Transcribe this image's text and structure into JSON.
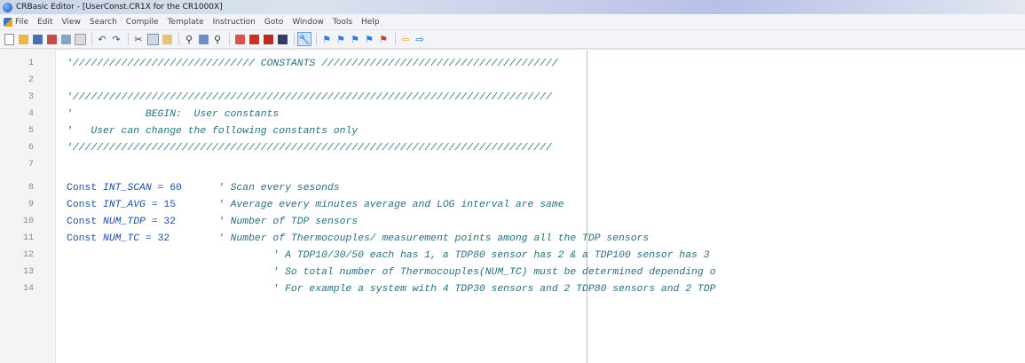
{
  "window": {
    "title": "CRBasic Editor - [UserConst.CR1X for the CR1000X]"
  },
  "menu": {
    "items": [
      "File",
      "Edit",
      "View",
      "Search",
      "Compile",
      "Template",
      "Instruction",
      "Goto",
      "Window",
      "Tools",
      "Help"
    ]
  },
  "toolbar": {
    "icons": [
      "new-file-icon",
      "open-file-icon",
      "save-icon",
      "save-all-icon",
      "print-icon",
      "print-preview-icon",
      "undo-icon",
      "redo-icon",
      "cut-icon",
      "copy-icon",
      "paste-icon",
      "find-icon",
      "replace-icon",
      "find-next-icon",
      "compile-icon",
      "compile-save-icon",
      "send-icon",
      "block-icon",
      "wrench-icon",
      "bookmark-toggle-icon",
      "bookmark-next-icon",
      "bookmark-prev-icon",
      "bookmark-clear-icon",
      "bookmark-list-icon",
      "back-arrow-icon",
      "forward-arrow-icon"
    ]
  },
  "editor": {
    "lines": [
      {
        "num": "1",
        "text": "'////////////////////////////// CONSTANTS ///////////////////////////////////////"
      },
      {
        "num": "2",
        "text": ""
      },
      {
        "num": "3",
        "text": "'///////////////////////////////////////////////////////////////////////////////"
      },
      {
        "num": "4",
        "text": "'            BEGIN:  User constants"
      },
      {
        "num": "5",
        "text": "'   User can change the following constants only"
      },
      {
        "num": "6",
        "text": "'///////////////////////////////////////////////////////////////////////////////"
      },
      {
        "num": "7",
        "text": ""
      },
      {
        "num": "8",
        "kw": "Const ",
        "var": "INT_SCAN",
        "op": " = 60",
        "cmt": "      ' Scan every sesonds"
      },
      {
        "num": "9",
        "kw": "Const ",
        "var": "INT_AVG",
        "op": " = 15",
        "cmt": "       ' Average every minutes average and LOG interval are same"
      },
      {
        "num": "10",
        "kw": "Const ",
        "var": "NUM_TDP",
        "op": " = 32",
        "cmt": "       ' Number of TDP sensors"
      },
      {
        "num": "11",
        "kw": "Const ",
        "var": "NUM_TC",
        "op": " = 32",
        "cmt": "        ' Number of Thermocouples/ measurement points among all the TDP sensors"
      },
      {
        "num": "12",
        "text": "                                  ' A TDP10/30/50 each has 1, a TDP80 sensor has 2 & a TDP100 sensor has 3"
      },
      {
        "num": "13",
        "text": "                                  ' So total number of Thermocouples(NUM_TC) must be determined depending o"
      },
      {
        "num": "14",
        "text": "                                  ' For example a system with 4 TDP30 sensors and 2 TDP80 sensors and 2 TDP"
      }
    ]
  },
  "colors": {
    "comment": "#2a6f80",
    "keyword": "#1b4f9c",
    "gutter_bg": "#f4f4f4"
  }
}
